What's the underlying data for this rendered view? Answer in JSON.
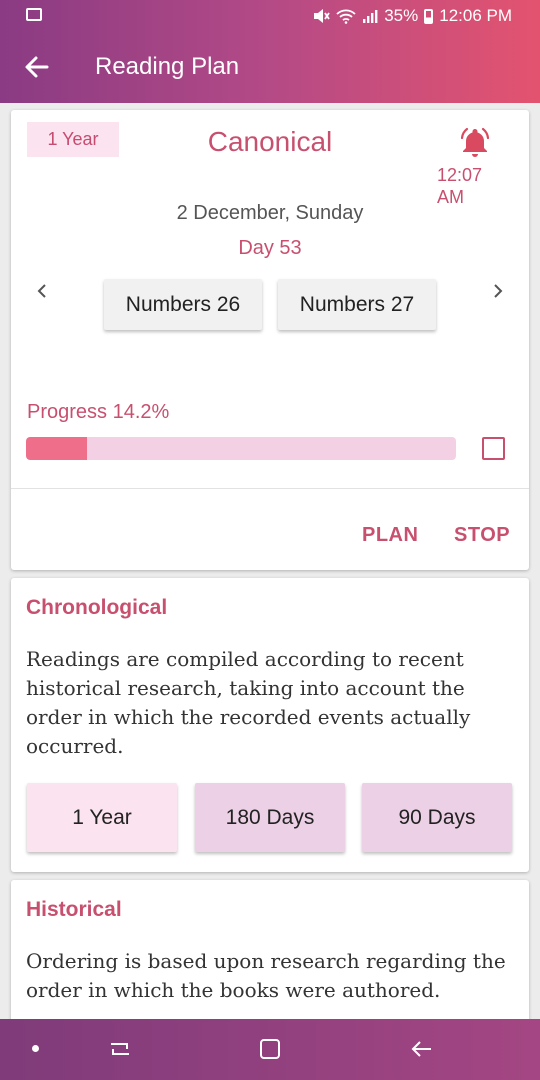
{
  "status_bar": {
    "battery": "35%",
    "time": "12:06 PM"
  },
  "header": {
    "title": "Reading Plan",
    "back_icon": "back-arrow-icon"
  },
  "current_plan": {
    "duration_tag": "1 Year",
    "name": "Canonical",
    "alarm_time": "12:07 AM",
    "date": "2 December, Sunday",
    "day": "Day 53",
    "readings": [
      "Numbers 26",
      "Numbers 27"
    ],
    "progress_label": "Progress 14.2%",
    "progress_percent": 14.2,
    "actions": {
      "plan": "PLAN",
      "stop": "STOP"
    }
  },
  "plans": [
    {
      "title": "Chronological",
      "description": "Readings are compiled according to recent historical research, taking into account the order in which the recorded events actually occurred.",
      "durations": [
        "1 Year",
        "180 Days",
        "90 Days"
      ]
    },
    {
      "title": "Historical",
      "description": "Ordering is based upon research regarding the order in which the books were authored."
    }
  ],
  "colors": {
    "accent": "#c8506f",
    "appbar_start": "#8a3b83",
    "appbar_end": "#e3536f"
  }
}
